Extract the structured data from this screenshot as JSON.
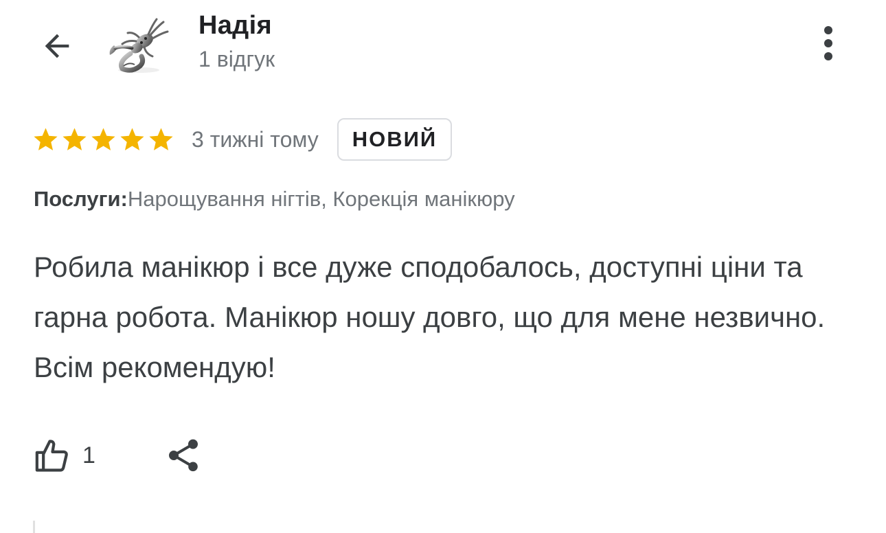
{
  "header": {
    "back_icon": "arrow-left-icon",
    "avatar_icon": "scorpion-avatar",
    "reviewer_name": "Надія",
    "reviewer_review_count": "1 відгук",
    "more_icon": "more-vert-icon"
  },
  "review": {
    "rating": 5,
    "rating_max": 5,
    "star_color": "#f4b400",
    "time_ago": "3 тижні тому",
    "badge": "НОВИЙ",
    "services_label": "Послуги:",
    "services_value": "Нарощування нігтів, Корекція манікюру",
    "text": "Робила манікюр і все дуже сподобалось, доступні ціни та гарна робота. Манікюр ношу довго, що для мене незвично. Всім рекомендую!"
  },
  "actions": {
    "like_icon": "thumb-up-icon",
    "like_count": "1",
    "share_icon": "share-icon"
  }
}
